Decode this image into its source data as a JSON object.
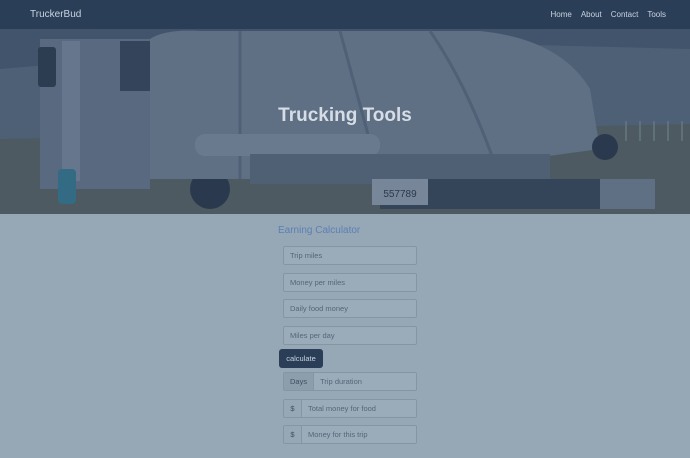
{
  "navbar": {
    "brand": "TruckerBud",
    "links": [
      "Home",
      "About",
      "Contact",
      "Tools"
    ]
  },
  "hero": {
    "title": "Trucking Tools",
    "license_plate": "557789"
  },
  "calculator": {
    "title": "Earning Calculator",
    "trip_miles_placeholder": "Trip miles",
    "money_per_mile_placeholder": "Money per miles",
    "daily_food_placeholder": "Daily food money",
    "miles_per_day_placeholder": "Miles per day",
    "calculate_label": "calculate",
    "days_addon": "Days",
    "trip_duration_placeholder": "Trip duration",
    "dollar_symbol": "$",
    "food_total_placeholder": "Total money for food",
    "trip_money_placeholder": "Money for this trip"
  },
  "colors": {
    "navbar": "#2a3e58",
    "page_background": "#96a7b5",
    "accent_title": "#5b80b6"
  }
}
